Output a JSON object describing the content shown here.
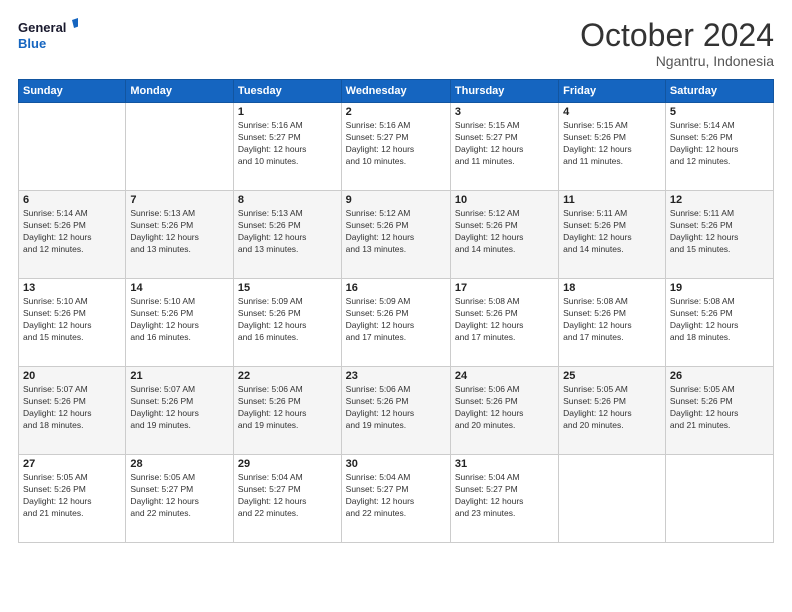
{
  "logo": {
    "line1": "General",
    "line2": "Blue"
  },
  "title": "October 2024",
  "subtitle": "Ngantru, Indonesia",
  "weekdays": [
    "Sunday",
    "Monday",
    "Tuesday",
    "Wednesday",
    "Thursday",
    "Friday",
    "Saturday"
  ],
  "weeks": [
    [
      {
        "day": "",
        "info": ""
      },
      {
        "day": "",
        "info": ""
      },
      {
        "day": "1",
        "info": "Sunrise: 5:16 AM\nSunset: 5:27 PM\nDaylight: 12 hours\nand 10 minutes."
      },
      {
        "day": "2",
        "info": "Sunrise: 5:16 AM\nSunset: 5:27 PM\nDaylight: 12 hours\nand 10 minutes."
      },
      {
        "day": "3",
        "info": "Sunrise: 5:15 AM\nSunset: 5:27 PM\nDaylight: 12 hours\nand 11 minutes."
      },
      {
        "day": "4",
        "info": "Sunrise: 5:15 AM\nSunset: 5:26 PM\nDaylight: 12 hours\nand 11 minutes."
      },
      {
        "day": "5",
        "info": "Sunrise: 5:14 AM\nSunset: 5:26 PM\nDaylight: 12 hours\nand 12 minutes."
      }
    ],
    [
      {
        "day": "6",
        "info": "Sunrise: 5:14 AM\nSunset: 5:26 PM\nDaylight: 12 hours\nand 12 minutes."
      },
      {
        "day": "7",
        "info": "Sunrise: 5:13 AM\nSunset: 5:26 PM\nDaylight: 12 hours\nand 13 minutes."
      },
      {
        "day": "8",
        "info": "Sunrise: 5:13 AM\nSunset: 5:26 PM\nDaylight: 12 hours\nand 13 minutes."
      },
      {
        "day": "9",
        "info": "Sunrise: 5:12 AM\nSunset: 5:26 PM\nDaylight: 12 hours\nand 13 minutes."
      },
      {
        "day": "10",
        "info": "Sunrise: 5:12 AM\nSunset: 5:26 PM\nDaylight: 12 hours\nand 14 minutes."
      },
      {
        "day": "11",
        "info": "Sunrise: 5:11 AM\nSunset: 5:26 PM\nDaylight: 12 hours\nand 14 minutes."
      },
      {
        "day": "12",
        "info": "Sunrise: 5:11 AM\nSunset: 5:26 PM\nDaylight: 12 hours\nand 15 minutes."
      }
    ],
    [
      {
        "day": "13",
        "info": "Sunrise: 5:10 AM\nSunset: 5:26 PM\nDaylight: 12 hours\nand 15 minutes."
      },
      {
        "day": "14",
        "info": "Sunrise: 5:10 AM\nSunset: 5:26 PM\nDaylight: 12 hours\nand 16 minutes."
      },
      {
        "day": "15",
        "info": "Sunrise: 5:09 AM\nSunset: 5:26 PM\nDaylight: 12 hours\nand 16 minutes."
      },
      {
        "day": "16",
        "info": "Sunrise: 5:09 AM\nSunset: 5:26 PM\nDaylight: 12 hours\nand 17 minutes."
      },
      {
        "day": "17",
        "info": "Sunrise: 5:08 AM\nSunset: 5:26 PM\nDaylight: 12 hours\nand 17 minutes."
      },
      {
        "day": "18",
        "info": "Sunrise: 5:08 AM\nSunset: 5:26 PM\nDaylight: 12 hours\nand 17 minutes."
      },
      {
        "day": "19",
        "info": "Sunrise: 5:08 AM\nSunset: 5:26 PM\nDaylight: 12 hours\nand 18 minutes."
      }
    ],
    [
      {
        "day": "20",
        "info": "Sunrise: 5:07 AM\nSunset: 5:26 PM\nDaylight: 12 hours\nand 18 minutes."
      },
      {
        "day": "21",
        "info": "Sunrise: 5:07 AM\nSunset: 5:26 PM\nDaylight: 12 hours\nand 19 minutes."
      },
      {
        "day": "22",
        "info": "Sunrise: 5:06 AM\nSunset: 5:26 PM\nDaylight: 12 hours\nand 19 minutes."
      },
      {
        "day": "23",
        "info": "Sunrise: 5:06 AM\nSunset: 5:26 PM\nDaylight: 12 hours\nand 19 minutes."
      },
      {
        "day": "24",
        "info": "Sunrise: 5:06 AM\nSunset: 5:26 PM\nDaylight: 12 hours\nand 20 minutes."
      },
      {
        "day": "25",
        "info": "Sunrise: 5:05 AM\nSunset: 5:26 PM\nDaylight: 12 hours\nand 20 minutes."
      },
      {
        "day": "26",
        "info": "Sunrise: 5:05 AM\nSunset: 5:26 PM\nDaylight: 12 hours\nand 21 minutes."
      }
    ],
    [
      {
        "day": "27",
        "info": "Sunrise: 5:05 AM\nSunset: 5:26 PM\nDaylight: 12 hours\nand 21 minutes."
      },
      {
        "day": "28",
        "info": "Sunrise: 5:05 AM\nSunset: 5:27 PM\nDaylight: 12 hours\nand 22 minutes."
      },
      {
        "day": "29",
        "info": "Sunrise: 5:04 AM\nSunset: 5:27 PM\nDaylight: 12 hours\nand 22 minutes."
      },
      {
        "day": "30",
        "info": "Sunrise: 5:04 AM\nSunset: 5:27 PM\nDaylight: 12 hours\nand 22 minutes."
      },
      {
        "day": "31",
        "info": "Sunrise: 5:04 AM\nSunset: 5:27 PM\nDaylight: 12 hours\nand 23 minutes."
      },
      {
        "day": "",
        "info": ""
      },
      {
        "day": "",
        "info": ""
      }
    ]
  ]
}
